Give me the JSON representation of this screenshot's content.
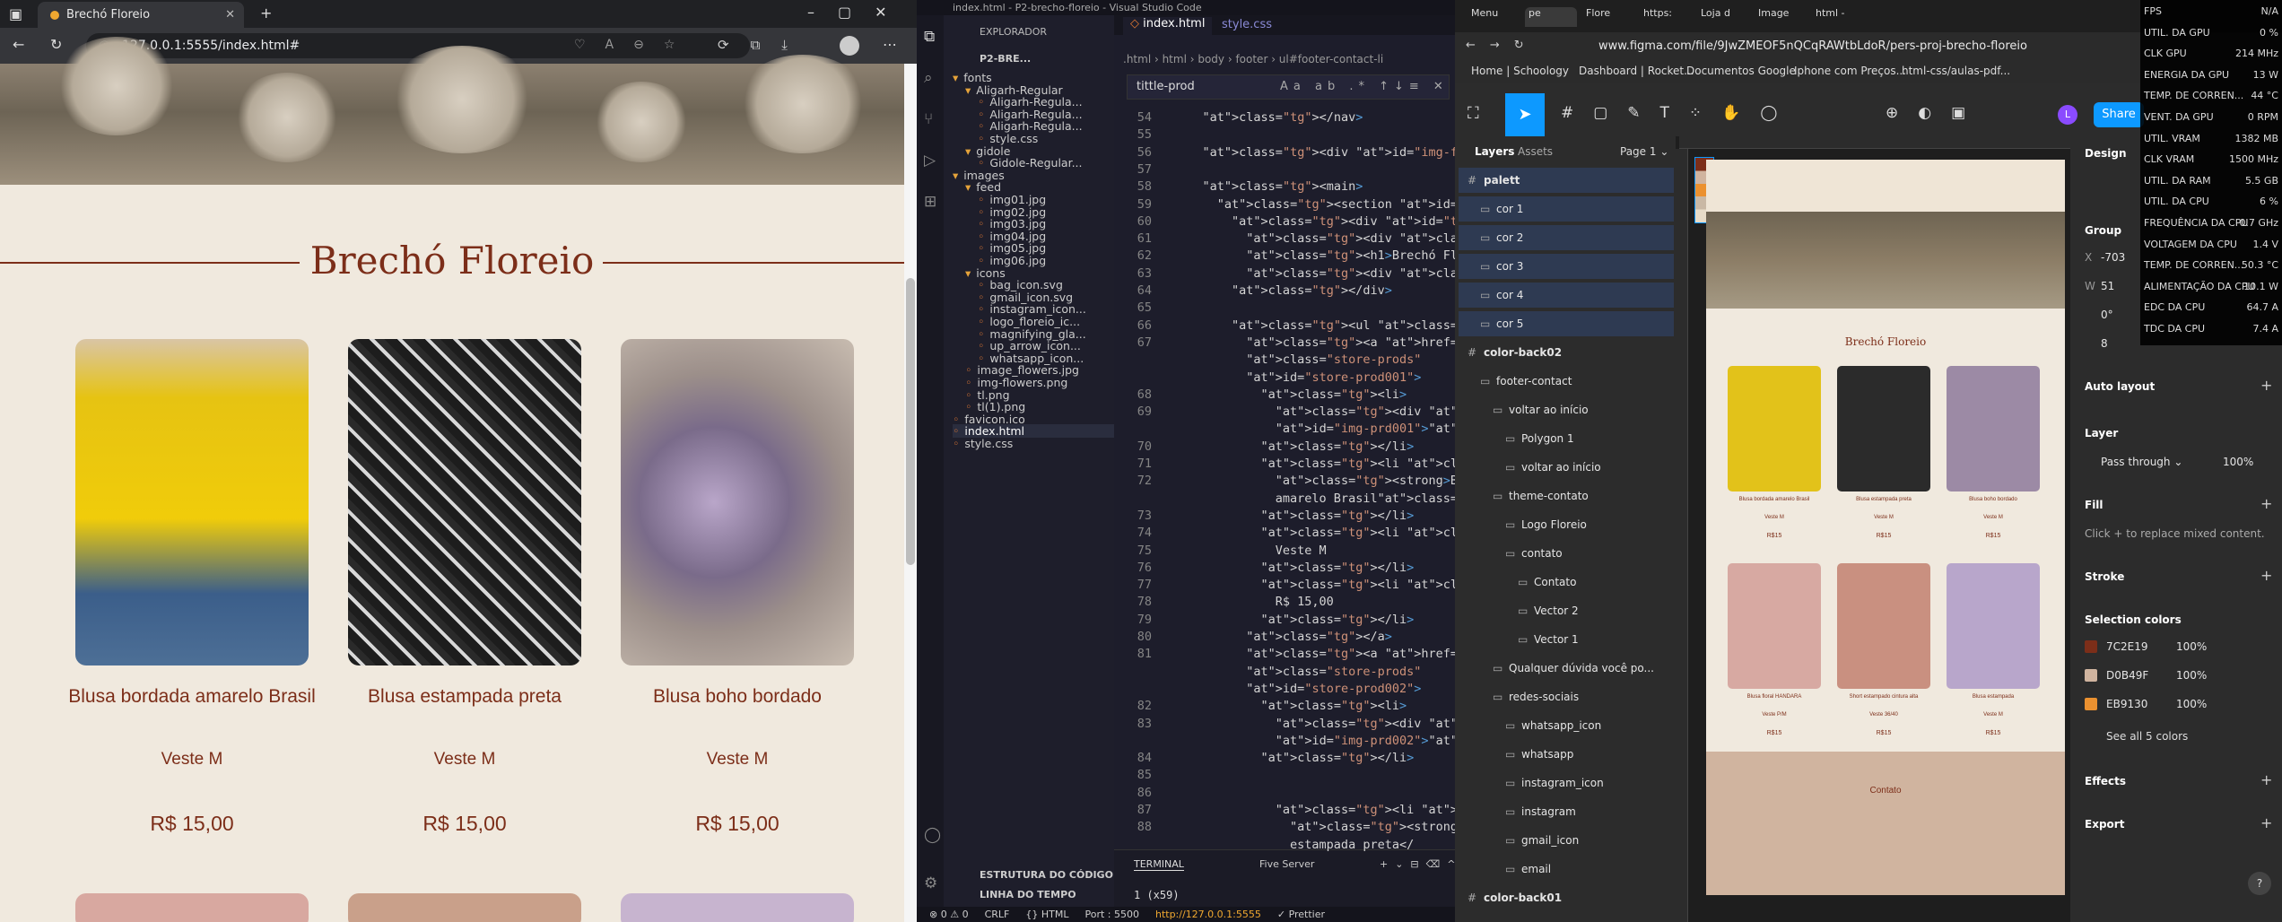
{
  "browser": {
    "tab_title": "Brechó Floreio",
    "url": "127.0.0.1:5555/index.html#",
    "brand": "Brechó Floreio",
    "products": [
      {
        "title": "Blusa bordada amarelo Brasil",
        "size": "Veste M",
        "price": "R$ 15,00"
      },
      {
        "title": "Blusa estampada preta",
        "size": "Veste M",
        "price": "R$ 15,00"
      },
      {
        "title": "Blusa boho bordado",
        "size": "Veste M",
        "price": "R$ 15,00"
      }
    ]
  },
  "vscode": {
    "title": "index.html - P2-brecho-floreio - Visual Studio Code",
    "explorer_label": "EXPLORADOR",
    "project": "P2-BRE...",
    "tabs": [
      "index.html",
      "style.css"
    ],
    "breadcrumb": ".html › html › body › footer › ul#footer-contact-li",
    "find_text": "tittle-prod",
    "tree": [
      "fonts",
      "Aligarh-Regular",
      "Aligarh-Regula...",
      "Aligarh-Regula...",
      "Aligarh-Regula...",
      "style.css",
      "gidole",
      "Gidole-Regular...",
      "images",
      "feed",
      "img01.jpg",
      "img02.jpg",
      "img03.jpg",
      "img04.jpg",
      "img05.jpg",
      "img06.jpg",
      "icons",
      "bag_icon.svg",
      "gmail_icon.svg",
      "instagram_icon...",
      "logo_floreio_ic...",
      "magnifying_gla...",
      "up_arrow_icon...",
      "whatsapp_icon...",
      "image_flowers.jpg",
      "img-flowers.png",
      "tl.png",
      "tl(1).png",
      "favicon.ico",
      "index.html",
      "style.css"
    ],
    "outline": "ESTRUTURA DO CÓDIGO",
    "timeline": "LINHA DO TEMPO",
    "terminal_label": "TERMINAL",
    "terminal_out": "1 (x59)",
    "five_server": "Five Server",
    "status": [
      "⊗ 0 ⚠ 0",
      "CRLF",
      "{} HTML",
      "Port : 5500",
      "http://127.0.0.1:5555",
      "✓ Prettier"
    ],
    "code": [
      {
        "n": "54",
        "t": "    </nav>"
      },
      {
        "n": "55",
        "t": ""
      },
      {
        "n": "56",
        "t": "    <div id=\"img-flowers\"></div>"
      },
      {
        "n": "57",
        "t": ""
      },
      {
        "n": "58",
        "t": "    <main>"
      },
      {
        "n": "59",
        "t": "      <section id=\"content-brecho\">"
      },
      {
        "n": "60",
        "t": "        <div id=\"theme-content\">"
      },
      {
        "n": "61",
        "t": "          <div class=\"line\"></div>"
      },
      {
        "n": "62",
        "t": "          <h1>Brechó Floreio</h1>"
      },
      {
        "n": "63",
        "t": "          <div class=\"line\"></div>"
      },
      {
        "n": "64",
        "t": "        </div>"
      },
      {
        "n": "65",
        "t": ""
      },
      {
        "n": "66",
        "t": "        <ul class=\"prods-rows\">"
      },
      {
        "n": "67",
        "t": "          <a href=\"#\""
      },
      {
        "n": "",
        "t": "          class=\"store-prods\""
      },
      {
        "n": "",
        "t": "          id=\"store-prod001\">"
      },
      {
        "n": "68",
        "t": "            <li>"
      },
      {
        "n": "69",
        "t": "              <div class=\"img-prd\""
      },
      {
        "n": "",
        "t": "              id=\"img-prd001\"></div>"
      },
      {
        "n": "70",
        "t": "            </li>"
      },
      {
        "n": "71",
        "t": "            <li class=\"tittle-prod\">"
      },
      {
        "n": "72",
        "t": "              <strong>Blusa bordada"
      },
      {
        "n": "",
        "t": "              amarelo Brasil</strong>"
      },
      {
        "n": "73",
        "t": "            </li>"
      },
      {
        "n": "74",
        "t": "            <li class=\"size-prod\">"
      },
      {
        "n": "75",
        "t": "              Veste M"
      },
      {
        "n": "76",
        "t": "            </li>"
      },
      {
        "n": "77",
        "t": "            <li class=\"price-prod\">"
      },
      {
        "n": "78",
        "t": "              R$ 15,00"
      },
      {
        "n": "79",
        "t": "            </li>"
      },
      {
        "n": "80",
        "t": "          </a>"
      },
      {
        "n": "81",
        "t": "          <a href=\"#\""
      },
      {
        "n": "",
        "t": "          class=\"store-prods\""
      },
      {
        "n": "",
        "t": "          id=\"store-prod002\">"
      },
      {
        "n": "82",
        "t": "            <li>"
      },
      {
        "n": "83",
        "t": "              <div class=\"img-prd\""
      },
      {
        "n": "",
        "t": "              id=\"img-prd002\"></div>"
      },
      {
        "n": "84",
        "t": "            </li>"
      },
      {
        "n": "85",
        "t": ""
      },
      {
        "n": "86",
        "t": ""
      },
      {
        "n": "87",
        "t": "              <li class=\"tittle-prod\">"
      },
      {
        "n": "88",
        "t": "                <strong>Blusa"
      },
      {
        "n": "",
        "t": "                estampada preta</"
      }
    ]
  },
  "figma": {
    "url": "www.figma.com/file/9JwZMEOF5nQCqRAWtbLdoR/pers-proj-brecho-floreio",
    "bookmarks": [
      "Home | Schoology",
      "Dashboard | Rocket...",
      "Documentos Google",
      "Iphone com Preços...",
      "html-css/aulas-pdf..."
    ],
    "browser_tabs": [
      "Menu",
      "pe",
      "Flore",
      "https:",
      "Loja d",
      "Image",
      "html -"
    ],
    "layer_tabs": [
      "Layers",
      "Assets"
    ],
    "page": "Page 1",
    "layers": [
      {
        "name": "palett",
        "depth": 0,
        "sel": true
      },
      {
        "name": "cor 1",
        "depth": 1,
        "sel": true
      },
      {
        "name": "cor 2",
        "depth": 1,
        "sel": true
      },
      {
        "name": "cor 3",
        "depth": 1,
        "sel": true
      },
      {
        "name": "cor 4",
        "depth": 1,
        "sel": true
      },
      {
        "name": "cor 5",
        "depth": 1,
        "sel": true
      },
      {
        "name": "color-back02",
        "depth": 0,
        "sel": false
      },
      {
        "name": "footer-contact",
        "depth": 1,
        "sel": false
      },
      {
        "name": "voltar ao início",
        "depth": 2,
        "sel": false
      },
      {
        "name": "Polygon 1",
        "depth": 3,
        "sel": false
      },
      {
        "name": "voltar ao início",
        "depth": 3,
        "sel": false
      },
      {
        "name": "theme-contato",
        "depth": 2,
        "sel": false
      },
      {
        "name": "Logo Floreio",
        "depth": 3,
        "sel": false
      },
      {
        "name": "contato",
        "depth": 3,
        "sel": false
      },
      {
        "name": "Contato",
        "depth": 4,
        "sel": false
      },
      {
        "name": "Vector 2",
        "depth": 4,
        "sel": false
      },
      {
        "name": "Vector 1",
        "depth": 4,
        "sel": false
      },
      {
        "name": "Qualquer dúvida você po...",
        "depth": 2,
        "sel": false
      },
      {
        "name": "redes-sociais",
        "depth": 2,
        "sel": false
      },
      {
        "name": "whatsapp_icon",
        "depth": 3,
        "sel": false
      },
      {
        "name": "whatsapp",
        "depth": 3,
        "sel": false
      },
      {
        "name": "instagram_icon",
        "depth": 3,
        "sel": false
      },
      {
        "name": "instagram",
        "depth": 3,
        "sel": false
      },
      {
        "name": "gmail_icon",
        "depth": 3,
        "sel": false
      },
      {
        "name": "email",
        "depth": 3,
        "sel": false
      },
      {
        "name": "color-back01",
        "depth": 0,
        "sel": false
      }
    ],
    "props": {
      "design_tab": "Design",
      "group": "Group",
      "x_label": "X",
      "x_val": "-703",
      "w_label": "W",
      "w_val": "51",
      "rot": "0°",
      "radius": "8",
      "auto_layout": "Auto layout",
      "layer": "Layer",
      "pass_through": "Pass through",
      "opacity": "100%",
      "fill": "Fill",
      "fill_hint": "Click + to replace mixed content.",
      "stroke": "Stroke",
      "selection_colors": "Selection colors",
      "colors": [
        {
          "hex": "7C2E19",
          "pct": "100%",
          "swatch": "#7C2E19"
        },
        {
          "hex": "D0B49F",
          "pct": "100%",
          "swatch": "#D0B49F"
        },
        {
          "hex": "EB9130",
          "pct": "100%",
          "swatch": "#EB9130"
        }
      ],
      "see_all": "See all 5 colors",
      "effects": "Effects",
      "export": "Export"
    },
    "share": "Share",
    "canvas_brand": "Brechó Floreio",
    "canvas_contact": "Contato",
    "canvas_products": [
      {
        "t": "Blusa bordada amarelo Brasil",
        "s": "Veste M",
        "p": "R$15"
      },
      {
        "t": "Blusa estampada preta",
        "s": "Veste M",
        "p": "R$15"
      },
      {
        "t": "Blusa boho bordado",
        "s": "Veste M",
        "p": "R$15"
      },
      {
        "t": "Blusa floral HANDARA",
        "s": "Veste P/M",
        "p": "R$15"
      },
      {
        "t": "Short estampado cintura alta",
        "s": "Veste 36/40",
        "p": "R$15"
      },
      {
        "t": "Blusa estampada",
        "s": "Veste M",
        "p": "R$15"
      }
    ]
  },
  "hw_overlay": [
    {
      "k": "FPS",
      "v": "N/A"
    },
    {
      "k": "UTIL. DA GPU",
      "v": "0 %"
    },
    {
      "k": "CLK GPU",
      "v": "214 MHz"
    },
    {
      "k": "ENERGIA DA GPU",
      "v": "13 W"
    },
    {
      "k": "TEMP. DE CORREN...",
      "v": "44 °C"
    },
    {
      "k": "VENT. DA GPU",
      "v": "0 RPM"
    },
    {
      "k": "UTIL. VRAM",
      "v": "1382 MB"
    },
    {
      "k": "CLK VRAM",
      "v": "1500 MHz"
    },
    {
      "k": "UTIL. DA RAM",
      "v": "5.5 GB"
    },
    {
      "k": "UTIL. DA CPU",
      "v": "6 %"
    },
    {
      "k": "FREQUÊNCIA DA CPU",
      "v": "0.7 GHz"
    },
    {
      "k": "VOLTAGEM DA CPU",
      "v": "1.4 V"
    },
    {
      "k": "TEMP. DE CORREN...",
      "v": "50.3 °C"
    },
    {
      "k": "ALIMENTAÇÃO DA CPU",
      "v": "10.1 W"
    },
    {
      "k": "EDC DA CPU",
      "v": "64.7 A"
    },
    {
      "k": "TDC DA CPU",
      "v": "7.4 A"
    }
  ]
}
